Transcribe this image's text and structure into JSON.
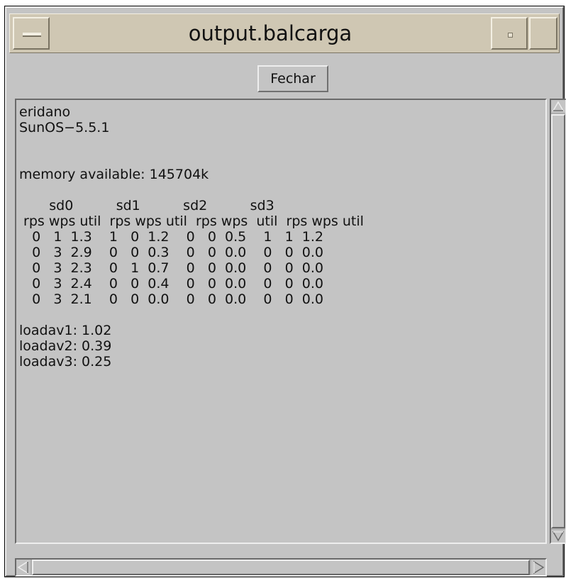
{
  "window": {
    "title": "output.balcarga"
  },
  "toolbar": {
    "close_label": "Fechar"
  },
  "output": {
    "text": "eridano\nSunOS−5.5.1\n\n\nmemory available: 145704k\n\n       sd0          sd1          sd2          sd3\n rps wps util  rps wps util  rps wps  util  rps wps util\n   0   1  1.3    1   0  1.2    0   0  0.5    1   1  1.2\n   0   3  2.9    0   0  0.3    0   0  0.0    0   0  0.0\n   0   3  2.3    0   1  0.7    0   0  0.0    0   0  0.0\n   0   3  2.4    0   0  0.4    0   0  0.0    0   0  0.0\n   0   3  2.1    0   0  0.0    0   0  0.0    0   0  0.0\n\nloadav1: 1.02\nloadav2: 0.39\nloadav3: 0.25"
  },
  "icons": {
    "window_menu": "window-menu-icon",
    "minimize": "minimize-icon",
    "maximize": "maximize-icon",
    "scroll_up": "arrow-up-icon",
    "scroll_down": "arrow-down-icon",
    "scroll_left": "arrow-left-icon",
    "scroll_right": "arrow-right-icon"
  },
  "colors": {
    "window_bg": "#c4c4c4",
    "titlebar_bg": "#cfc7b3"
  }
}
